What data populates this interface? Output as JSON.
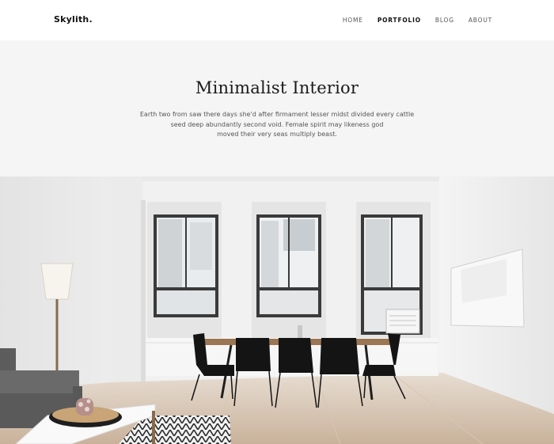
{
  "brand": {
    "logo": "Skylith."
  },
  "nav": {
    "items": [
      {
        "label": "HOME"
      },
      {
        "label": "PORTFOLIO",
        "active": true
      },
      {
        "label": "BLOG"
      },
      {
        "label": "ABOUT"
      }
    ]
  },
  "hero": {
    "title": "Minimalist Interior",
    "lines": [
      "Earth two from saw there days she'd after firmament lesser midst divided every cattle",
      "seed deep abundantly second void. Female spirit may likeness god",
      "moved their very seas multiply beast."
    ]
  },
  "colors": {
    "hero_bg": "#f5f5f5",
    "text_dark": "#111111",
    "text_muted": "#555555"
  }
}
